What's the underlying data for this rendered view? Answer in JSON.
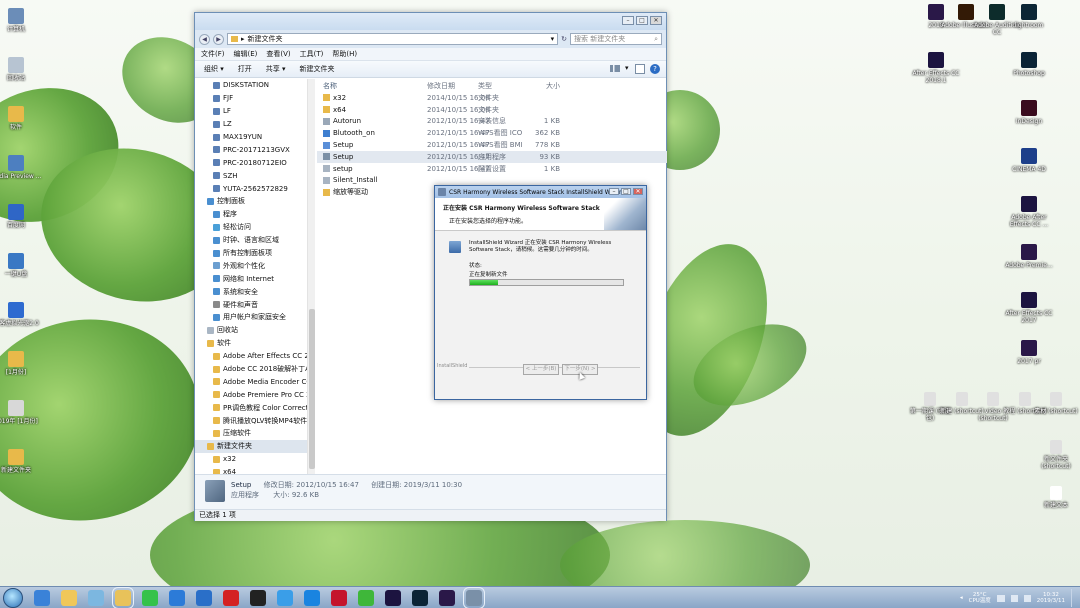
{
  "desktop": {
    "left_icons": [
      {
        "label": "计算机",
        "icon": "computer-icon",
        "color": "#6b8db8"
      },
      {
        "label": "回收站",
        "icon": "recycle-bin-icon",
        "color": "#b7c4d2"
      },
      {
        "label": "软件",
        "icon": "folder-icon",
        "color": "#e8b94a"
      },
      {
        "label": "Media Preview ...",
        "icon": "media-preview-icon",
        "color": "#4d7fc0"
      },
      {
        "label": "百度网",
        "icon": "baidu-icon",
        "color": "#2f66c6"
      },
      {
        "label": "一键U盘",
        "icon": "usb-icon",
        "color": "#3a78c4"
      },
      {
        "label": "极客虚拟光驱2.0",
        "icon": "virtual-drive-icon",
        "color": "#2e6bd0"
      },
      {
        "label": "[1月份]",
        "icon": "folder-icon",
        "color": "#e8b94a"
      },
      {
        "label": "2019年 [1月份]",
        "icon": "document-icon",
        "color": "#d8d8d8"
      },
      {
        "label": "新建文件夹",
        "icon": "folder-icon",
        "color": "#e8b94a"
      }
    ],
    "right_icons": [
      {
        "label": "2018",
        "icon": "premiere-icon",
        "color": "#2a1848"
      },
      {
        "label": "Adobe Illustrat...",
        "icon": "illustrator-icon",
        "color": "#331a06"
      },
      {
        "label": "Adobe Audition CC",
        "icon": "audition-icon",
        "color": "#0d2c2b"
      },
      {
        "label": "lightroom",
        "icon": "lightroom-icon",
        "color": "#0c2635"
      },
      {
        "label": "After Effects CC 2018.1",
        "icon": "after-effects-icon",
        "color": "#1c1440"
      },
      {
        "label": "Photoshop",
        "icon": "photoshop-icon",
        "color": "#0b2436"
      },
      {
        "label": "InDesign",
        "icon": "indesign-icon",
        "color": "#3a0c1e"
      },
      {
        "label": "CINEMA 4D",
        "icon": "cinema4d-icon",
        "color": "#1d3f8a"
      },
      {
        "label": "Adobe After Effects CC ...",
        "icon": "after-effects-icon",
        "color": "#1c1440"
      },
      {
        "label": "Adobe Premie...",
        "icon": "premiere-icon",
        "color": "#2a1848"
      },
      {
        "label": "After Effects CC 2017",
        "icon": "after-effects-icon",
        "color": "#1c1440"
      },
      {
        "label": "2017 pr",
        "icon": "premiere-icon",
        "color": "#2a1848"
      }
    ],
    "bottom_right_icons": [
      {
        "label": "第一期课 (安装包)",
        "icon": "shortcut-icon",
        "color": "#e0e0e0"
      },
      {
        "label": "新建 (shortcut)",
        "icon": "shortcut-icon",
        "color": "#e0e0e0"
      },
      {
        "label": "video (shortcut)",
        "icon": "shortcut-icon",
        "color": "#e0e0e0"
      },
      {
        "label": "教程 (shortcut)",
        "icon": "shortcut-icon",
        "color": "#e0e0e0"
      },
      {
        "label": "素材 (shortcut)",
        "icon": "shortcut-icon",
        "color": "#e0e0e0"
      },
      {
        "label": "新文件夹 (shortcut)",
        "icon": "shortcut-icon",
        "color": "#e0e0e0"
      },
      {
        "label": "新建文本",
        "icon": "text-file-icon",
        "color": "#ffffff"
      }
    ]
  },
  "explorer": {
    "address_path": "新建文件夹",
    "search_placeholder": "搜索 新建文件夹",
    "menu": [
      "文件(F)",
      "编辑(E)",
      "查看(V)",
      "工具(T)",
      "帮助(H)"
    ],
    "toolbar": [
      "组织 ▾",
      "打开",
      "共享 ▾",
      "新建文件夹"
    ],
    "nav_items": [
      {
        "label": "DISKSTATION",
        "level": 1,
        "icon": "#5a7fb5",
        "sel": false
      },
      {
        "label": "FJF",
        "level": 1,
        "icon": "#5a7fb5",
        "sel": false
      },
      {
        "label": "LF",
        "level": 1,
        "icon": "#5a7fb5",
        "sel": false
      },
      {
        "label": "LZ",
        "level": 1,
        "icon": "#5a7fb5",
        "sel": false
      },
      {
        "label": "MAX19YUN",
        "level": 1,
        "icon": "#5a7fb5",
        "sel": false
      },
      {
        "label": "PRC-20171213GVX",
        "level": 1,
        "icon": "#5a7fb5",
        "sel": false
      },
      {
        "label": "PRC-20180712EIO",
        "level": 1,
        "icon": "#5a7fb5",
        "sel": false
      },
      {
        "label": "SZH",
        "level": 1,
        "icon": "#5a7fb5",
        "sel": false
      },
      {
        "label": "YUTA-2562572829",
        "level": 1,
        "icon": "#5a7fb5",
        "sel": false
      },
      {
        "label": "控制面板",
        "level": 0,
        "icon": "#4a8fd0",
        "sel": false
      },
      {
        "label": "程序",
        "level": 1,
        "icon": "#4a8fd0",
        "sel": false
      },
      {
        "label": "轻松访问",
        "level": 1,
        "icon": "#4aa0d8",
        "sel": false
      },
      {
        "label": "时钟、语言和区域",
        "level": 1,
        "icon": "#4a8fd0",
        "sel": false
      },
      {
        "label": "所有控制面板项",
        "level": 1,
        "icon": "#4a8fd0",
        "sel": false
      },
      {
        "label": "外观和个性化",
        "level": 1,
        "icon": "#6c9fd0",
        "sel": false
      },
      {
        "label": "网络和 Internet",
        "level": 1,
        "icon": "#4a8fd0",
        "sel": false
      },
      {
        "label": "系统和安全",
        "level": 1,
        "icon": "#4a8fd0",
        "sel": false
      },
      {
        "label": "硬件和声音",
        "level": 1,
        "icon": "#8a8a8a",
        "sel": false
      },
      {
        "label": "用户帐户和家庭安全",
        "level": 1,
        "icon": "#4a8fd0",
        "sel": false
      },
      {
        "label": "回收站",
        "level": 0,
        "icon": "#a9b6c4",
        "sel": false
      },
      {
        "label": "软件",
        "level": 0,
        "icon": "#e8b94a",
        "sel": false
      },
      {
        "label": "Adobe After Effects CC 2018 Win",
        "level": 1,
        "icon": "#e8b94a",
        "sel": false
      },
      {
        "label": "Adobe CC 2018破解补丁Anticloud",
        "level": 1,
        "icon": "#e8b94a",
        "sel": false
      },
      {
        "label": "Adobe Media Encoder CC 2018 Win",
        "level": 1,
        "icon": "#e8b94a",
        "sel": false
      },
      {
        "label": "Adobe Premiere Pro CC 2018 Win",
        "level": 1,
        "icon": "#e8b94a",
        "sel": false
      },
      {
        "label": "PR调色教程 Color Correction in Pre",
        "level": 1,
        "icon": "#e8b94a",
        "sel": false
      },
      {
        "label": "腾讯播放QLV转换MP4软件",
        "level": 1,
        "icon": "#e8b94a",
        "sel": false
      },
      {
        "label": "压缩软件",
        "level": 1,
        "icon": "#e8b94a",
        "sel": false
      },
      {
        "label": "新建文件夹",
        "level": 0,
        "icon": "#e8b94a",
        "sel": true
      },
      {
        "label": "x32",
        "level": 1,
        "icon": "#e8b94a",
        "sel": false
      },
      {
        "label": "x64",
        "level": 1,
        "icon": "#e8b94a",
        "sel": false
      }
    ],
    "columns": [
      "名称",
      "修改日期",
      "类型",
      "大小"
    ],
    "files": [
      {
        "name": "x32",
        "date": "2014/10/15 16:08",
        "type": "文件夹",
        "size": "",
        "icon": "#e8b94a",
        "sel": false
      },
      {
        "name": "x64",
        "date": "2014/10/15 16:08",
        "type": "文件夹",
        "size": "",
        "icon": "#e8b94a",
        "sel": false
      },
      {
        "name": "Autorun",
        "date": "2012/10/15 16:47",
        "type": "安装信息",
        "size": "1 KB",
        "icon": "#9aa8b8",
        "sel": false
      },
      {
        "name": "Blutooth_on",
        "date": "2012/10/15 16:47",
        "type": "WPS看图 ICO 图...",
        "size": "362 KB",
        "icon": "#3f7fd0",
        "sel": false
      },
      {
        "name": "Setup",
        "date": "2012/10/15 16:47",
        "type": "WPS看图 BMP 图...",
        "size": "778 KB",
        "icon": "#5a8fd8",
        "sel": false
      },
      {
        "name": "Setup",
        "date": "2012/10/15 16:47",
        "type": "应用程序",
        "size": "93 KB",
        "icon": "#7b8fa5",
        "sel": true
      },
      {
        "name": "setup",
        "date": "2012/10/15 16:47",
        "type": "配置设置",
        "size": "1 KB",
        "icon": "#a8b4c2",
        "sel": false
      },
      {
        "name": "Silent_Install",
        "date": "",
        "type": "",
        "size": "",
        "icon": "#a8b4c2",
        "sel": false
      },
      {
        "name": "缩放等驱动",
        "date": "",
        "type": "",
        "size": "",
        "icon": "#e8b94a",
        "sel": false
      }
    ],
    "details": {
      "name": "Setup",
      "modified": "修改日期: 2012/10/15 16:47",
      "created": "创建日期: 2019/3/11 10:30",
      "type": "应用程序",
      "size": "大小: 92.6 KB"
    },
    "status": "已选择 1 项"
  },
  "wizard": {
    "title": "CSR Harmony Wireless Software Stack InstallShield Wizard",
    "heading": "正在安装 CSR Harmony Wireless Software Stack",
    "subheading": "正在安装您选择的程序功能。",
    "message": "InstallShield Wizard 正在安装 CSR Harmony Wireless Software Stack，请稍候。这需要几分钟的时间。",
    "status_label": "状态:",
    "status_value": "正在复制新文件",
    "progress": 0.18,
    "footer": "InstallShield",
    "back": "< 上一步(B)",
    "next": "下一步(N) >"
  },
  "taskbar": {
    "apps": [
      {
        "icon": "ie-icon",
        "color": "#3a82d8"
      },
      {
        "icon": "folder-icon",
        "color": "#f0c75a"
      },
      {
        "icon": "tool-icon",
        "color": "#7cb7e0"
      },
      {
        "icon": "explorer-icon",
        "color": "#e8c25a"
      },
      {
        "icon": "wechat-icon",
        "color": "#35c24a"
      },
      {
        "icon": "u-disk-icon",
        "color": "#2c7bd8"
      },
      {
        "icon": "browser-icon",
        "color": "#2a6fc8"
      },
      {
        "icon": "netease-music-icon",
        "color": "#d42222"
      },
      {
        "icon": "qq-icon",
        "color": "#222222"
      },
      {
        "icon": "baidu-netdisk-icon",
        "color": "#3a9ee8"
      },
      {
        "icon": "kugou-icon",
        "color": "#1a84e0"
      },
      {
        "icon": "red-app-icon",
        "color": "#c4142c"
      },
      {
        "icon": "green-app-icon",
        "color": "#3fb73a"
      },
      {
        "icon": "after-effects-icon",
        "color": "#1c1440"
      },
      {
        "icon": "photoshop-icon",
        "color": "#0b2436"
      },
      {
        "icon": "premiere-icon",
        "color": "#2a1848"
      },
      {
        "icon": "installer-icon",
        "color": "#7a90a8"
      }
    ],
    "temperature": "25°C",
    "cpu_label": "CPU温度",
    "time": "10:32",
    "date": "2019/3/11"
  }
}
